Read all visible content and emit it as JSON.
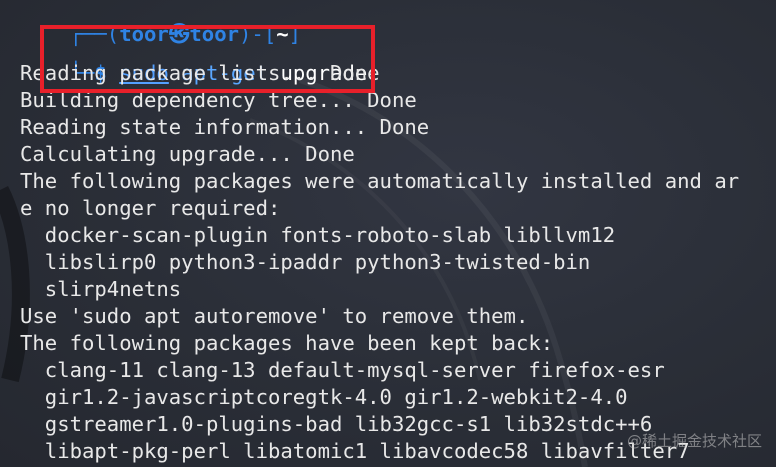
{
  "prompt": {
    "top_prefix": "┌──(",
    "user_host": "toor㉿toor",
    "mid": ")-[",
    "dir": "~",
    "end": "]",
    "corner": "└─",
    "dollar": "$",
    "sudo": "sudo",
    "command": "apt-get",
    "argument": "upgrade"
  },
  "output_lines": [
    "Reading package lists... Done",
    "Building dependency tree... Done",
    "Reading state information... Done",
    "Calculating upgrade... Done",
    "The following packages were automatically installed and ar",
    "e no longer required:",
    "  docker-scan-plugin fonts-roboto-slab libllvm12",
    "  libslirp0 python3-ipaddr python3-twisted-bin",
    "  slirp4netns",
    "Use 'sudo apt autoremove' to remove them.",
    "The following packages have been kept back:",
    "  clang-11 clang-13 default-mysql-server firefox-esr",
    "  gir1.2-javascriptcoregtk-4.0 gir1.2-webkit2-4.0",
    "  gstreamer1.0-plugins-bad lib32gcc-s1 lib32stdc++6",
    "  libapt-pkg-perl libatomic1 libavcodec58 libavfilter7"
  ],
  "watermark": "@稀土掘金技术社区",
  "colors": {
    "background": "#2a2e37",
    "prompt_blue": "#2f83e4",
    "text": "#e8e8e8",
    "highlight_red": "#e8202a"
  }
}
